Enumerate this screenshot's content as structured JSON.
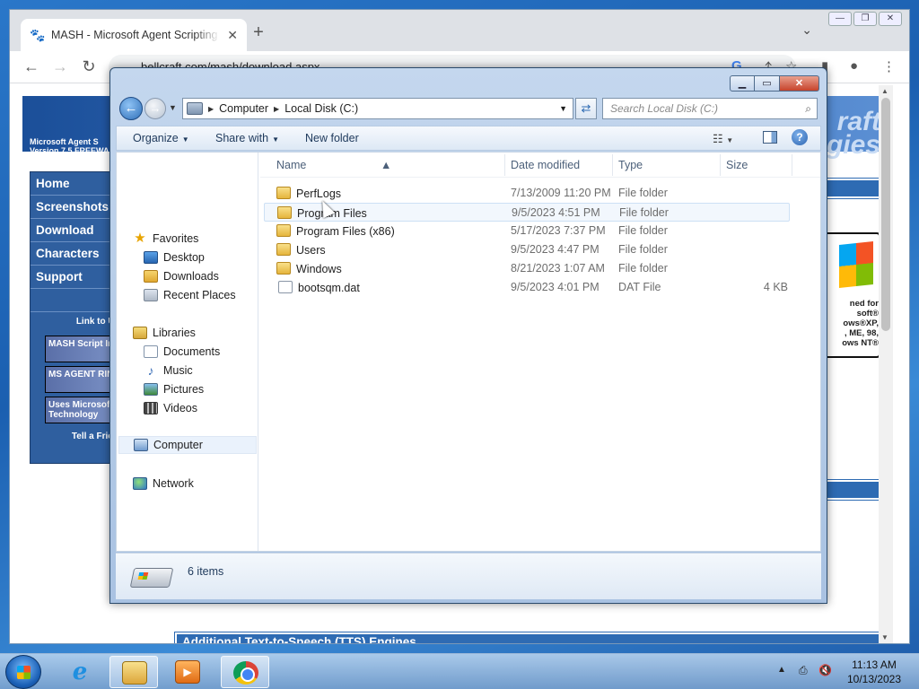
{
  "browser": {
    "tab_title": "MASH - Microsoft Agent Scripting Helper",
    "tab_favicon": "paw-icon",
    "url": "bellcraft.com/mash/download.aspx"
  },
  "webpage": {
    "logo_line1": "Microsoft Agent S",
    "logo_line2": "Version 7.5 FREEWAR",
    "banner_right_line1": "raft",
    "banner_right_line2": "ogies",
    "nav": [
      "Home",
      "Screenshots",
      "Download",
      "Characters",
      "Support"
    ],
    "link_to_us": "Link to Us",
    "badges": [
      "MASH Script Inside",
      "MS AGENT RING",
      "Uses Microsoft Agent Technology"
    ],
    "tell_a_friend": "Tell a Friend",
    "windows_box": {
      "line1": "ned for",
      "line2": "soft®",
      "line3": "ows®XP,",
      "line4": ", ME, 98,",
      "line5": "ows NT®"
    },
    "tts_heading": "Additional Text-to-Speech (TTS) Engines"
  },
  "explorer": {
    "breadcrumb": [
      "Computer",
      "Local Disk (C:)"
    ],
    "search_placeholder": "Search Local Disk (C:)",
    "commands": {
      "organize": "Organize",
      "share_with": "Share with",
      "new_folder": "New folder"
    },
    "navpane": {
      "favorites": "Favorites",
      "desktop": "Desktop",
      "downloads": "Downloads",
      "recent_places": "Recent Places",
      "libraries": "Libraries",
      "documents": "Documents",
      "music": "Music",
      "pictures": "Pictures",
      "videos": "Videos",
      "computer": "Computer",
      "network": "Network"
    },
    "columns": {
      "name": "Name",
      "date_modified": "Date modified",
      "type": "Type",
      "size": "Size"
    },
    "files": [
      {
        "name": "PerfLogs",
        "date": "7/13/2009 11:20 PM",
        "type": "File folder",
        "size": "",
        "kind": "folder"
      },
      {
        "name": "Program Files",
        "date": "9/5/2023 4:51 PM",
        "type": "File folder",
        "size": "",
        "kind": "folder"
      },
      {
        "name": "Program Files (x86)",
        "date": "5/17/2023 7:37 PM",
        "type": "File folder",
        "size": "",
        "kind": "folder"
      },
      {
        "name": "Users",
        "date": "9/5/2023 4:47 PM",
        "type": "File folder",
        "size": "",
        "kind": "folder"
      },
      {
        "name": "Windows",
        "date": "8/21/2023 1:07 AM",
        "type": "File folder",
        "size": "",
        "kind": "folder"
      },
      {
        "name": "bootsqm.dat",
        "date": "9/5/2023 4:01 PM",
        "type": "DAT File",
        "size": "4 KB",
        "kind": "file"
      }
    ],
    "item_count": "6 items"
  },
  "taskbar": {
    "apps": [
      "internet-explorer-icon",
      "windows-explorer-icon",
      "media-player-icon",
      "chrome-icon"
    ],
    "time": "11:13 AM",
    "date": "10/13/2023"
  }
}
